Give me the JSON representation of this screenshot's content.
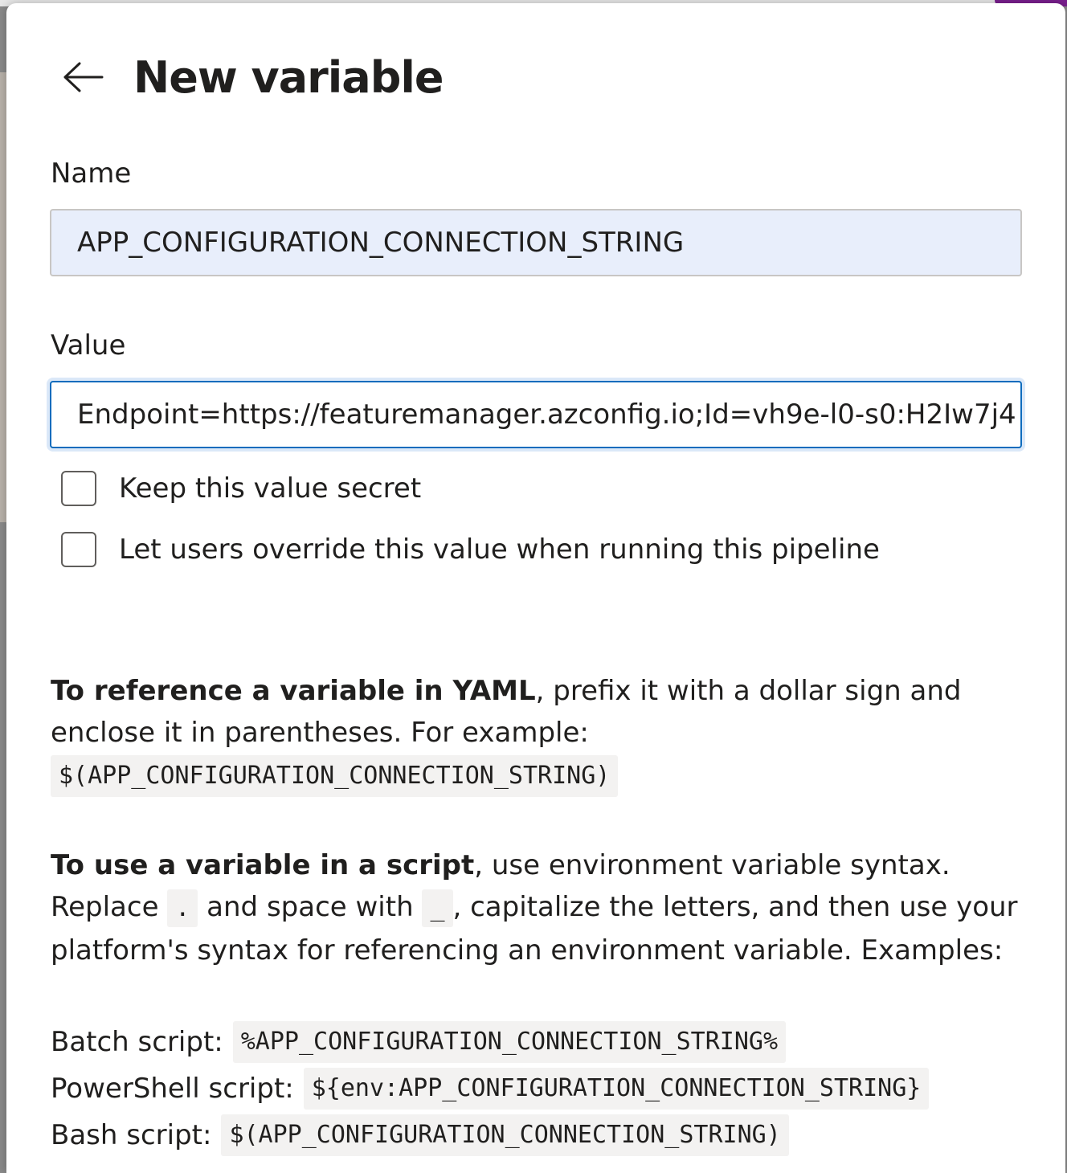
{
  "dialog": {
    "title": "New variable",
    "name_label": "Name",
    "name_value": "APP_CONFIGURATION_CONNECTION_STRING",
    "value_label": "Value",
    "value_value": "Endpoint=https://featuremanager.azconfig.io;Id=vh9e-l0-s0:H2Iw7j4",
    "checkbox_secret": "Keep this value secret",
    "checkbox_override": "Let users override this value when running this pipeline"
  },
  "help": {
    "yaml_bold": "To reference a variable in YAML",
    "yaml_text": ", prefix it with a dollar sign and enclose it in parentheses. For example:",
    "yaml_code": "$(APP_CONFIGURATION_CONNECTION_STRING)",
    "script_bold": "To use a variable in a script",
    "script_text1": ", use environment variable syntax. Replace ",
    "script_code_dot": ".",
    "script_text2": " and space with ",
    "script_code_underscore": "_",
    "script_text3": ", capitalize the letters, and then use your platform's syntax for referencing an environment variable. Examples:",
    "examples": [
      {
        "label": "Batch script:",
        "code": "%APP_CONFIGURATION_CONNECTION_STRING%"
      },
      {
        "label": "PowerShell script:",
        "code": "${env:APP_CONFIGURATION_CONNECTION_STRING}"
      },
      {
        "label": "Bash script:",
        "code": "$(APP_CONFIGURATION_CONNECTION_STRING)"
      }
    ]
  },
  "colors": {
    "focus_border": "#0f6cbd",
    "name_fill": "#e8eefb",
    "accent": "#7a1f8e"
  },
  "icons": {
    "back": "arrow-left-icon"
  }
}
